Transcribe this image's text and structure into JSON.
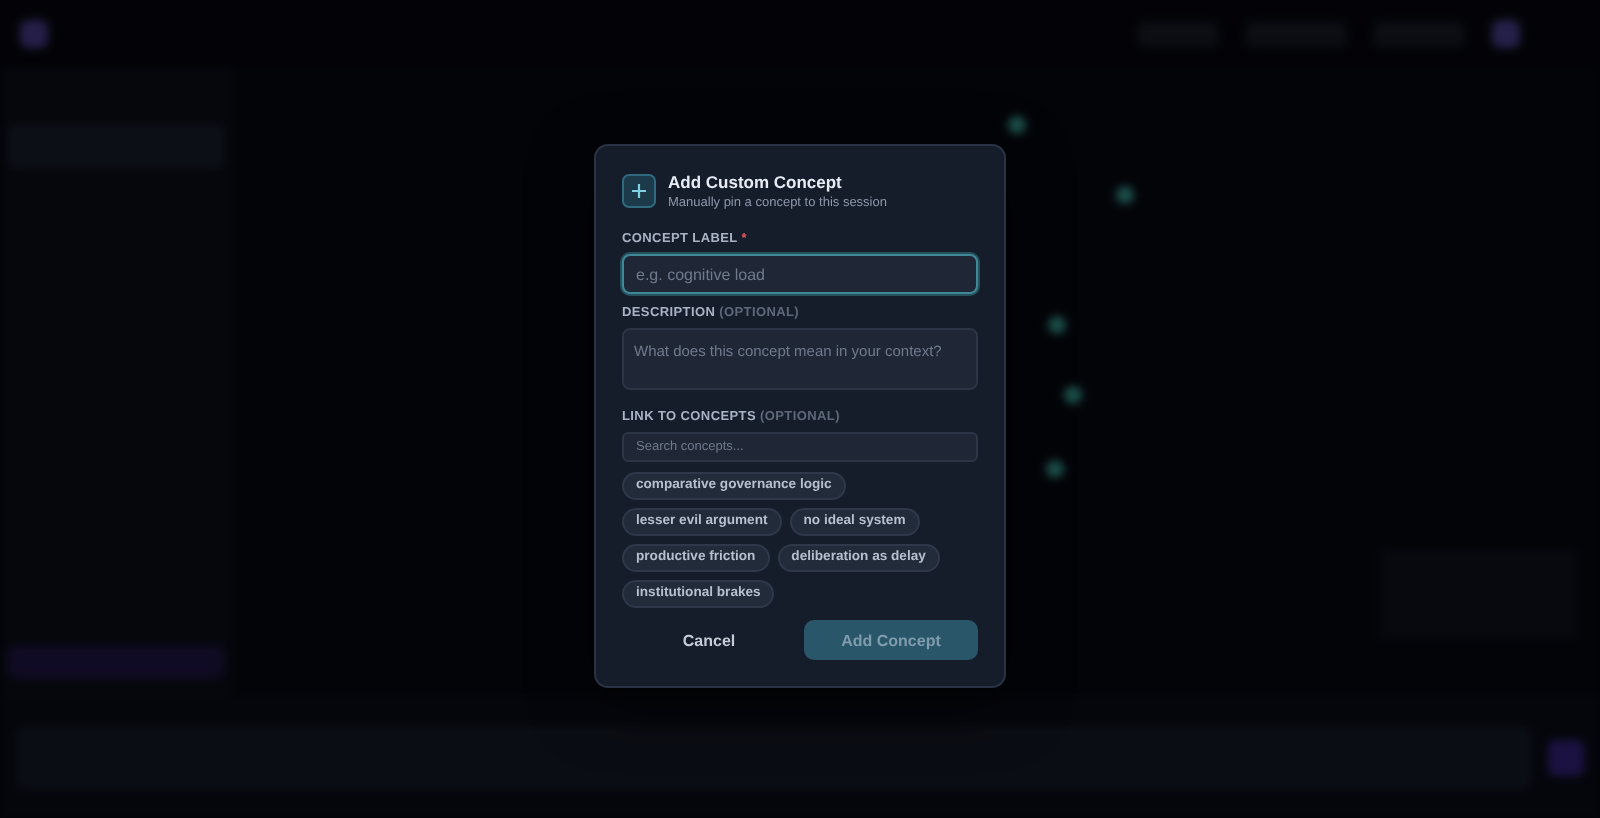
{
  "dialog": {
    "title": "Add Custom Concept",
    "subtitle": "Manually pin a concept to this session",
    "fields": [
      {
        "kind": "input",
        "label": "CONCEPT LABEL",
        "required_mark": "*",
        "placeholder": "e.g. cognitive load",
        "focused": true
      },
      {
        "kind": "textarea",
        "label": "DESCRIPTION",
        "hint": "(OPTIONAL)",
        "placeholder": "What does this concept mean in your context?",
        "focused": false
      }
    ],
    "link": {
      "label": "LINK TO CONCEPTS",
      "hint": "(OPTIONAL)",
      "search_placeholder": "Search concepts...",
      "chips": [
        {
          "label": "comparative governance logic",
          "selected": false
        },
        {
          "label": "lesser evil argument",
          "selected": false
        },
        {
          "label": "no ideal system",
          "selected": false
        },
        {
          "label": "productive friction",
          "selected": false
        },
        {
          "label": "deliberation as delay",
          "selected": false
        },
        {
          "label": "institutional brakes",
          "selected": false
        }
      ]
    },
    "buttons": [
      {
        "kind": "cancel",
        "label": "Cancel",
        "disabled": false
      },
      {
        "kind": "primary",
        "label": "Add Concept",
        "disabled": true
      }
    ]
  }
}
